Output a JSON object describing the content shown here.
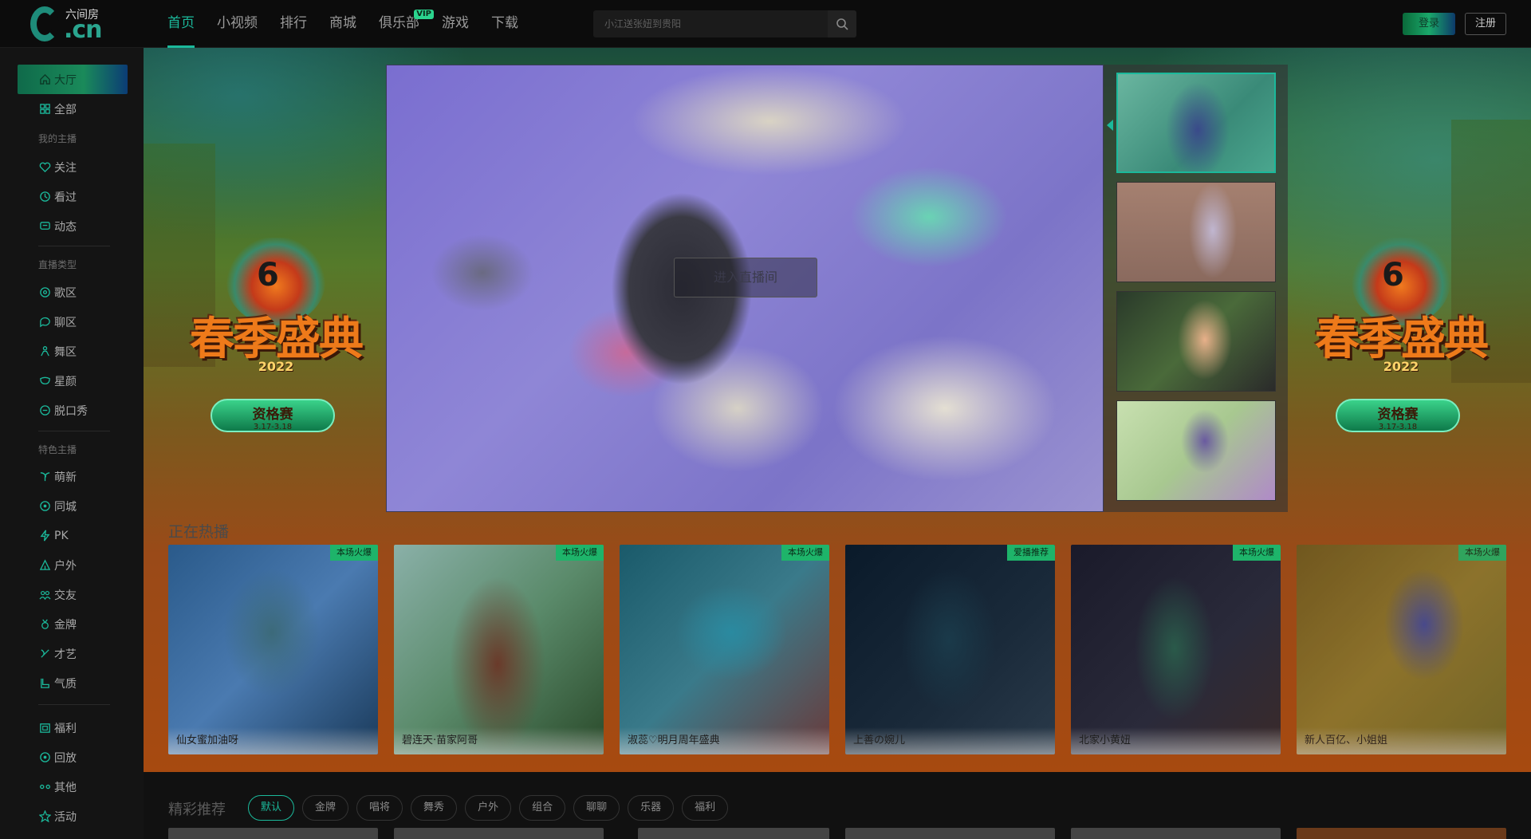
{
  "header": {
    "logo_text": "六间房",
    "logo_domain": ".cn",
    "nav": [
      {
        "label": "首页",
        "active": true
      },
      {
        "label": "小视频"
      },
      {
        "label": "排行"
      },
      {
        "label": "商城"
      },
      {
        "label": "俱乐部",
        "badge": "VIP"
      },
      {
        "label": "游戏"
      },
      {
        "label": "下载"
      }
    ],
    "search_placeholder": "小江送张妞到贵阳",
    "login_label": "登录",
    "register_label": "注册"
  },
  "sidebar": {
    "top_items": [
      {
        "label": "大厅",
        "icon": "home-icon",
        "active": true
      },
      {
        "label": "全部",
        "icon": "grid-icon"
      }
    ],
    "section_my": "我的主播",
    "my_items": [
      {
        "label": "关注",
        "icon": "heart-icon"
      },
      {
        "label": "看过",
        "icon": "clock-icon"
      },
      {
        "label": "动态",
        "icon": "message-icon"
      }
    ],
    "section_type": "直播类型",
    "type_items": [
      {
        "label": "歌区",
        "icon": "disc-icon"
      },
      {
        "label": "聊区",
        "icon": "chat-icon"
      },
      {
        "label": "舞区",
        "icon": "dance-icon"
      },
      {
        "label": "星颜",
        "icon": "mask-icon"
      },
      {
        "label": "脱口秀",
        "icon": "talk-icon"
      }
    ],
    "section_feature": "特色主播",
    "feature_items": [
      {
        "label": "萌新",
        "icon": "sprout-icon"
      },
      {
        "label": "同城",
        "icon": "location-icon"
      },
      {
        "label": "PK",
        "icon": "lightning-icon"
      },
      {
        "label": "户外",
        "icon": "tent-icon"
      },
      {
        "label": "交友",
        "icon": "friends-icon"
      },
      {
        "label": "金牌",
        "icon": "medal-icon"
      },
      {
        "label": "才艺",
        "icon": "talent-icon"
      },
      {
        "label": "气质",
        "icon": "boot-icon"
      }
    ],
    "extra_items": [
      {
        "label": "福利",
        "icon": "gift-icon"
      },
      {
        "label": "回放",
        "icon": "replay-icon"
      },
      {
        "label": "其他",
        "icon": "dots-icon"
      },
      {
        "label": "活动",
        "icon": "star-icon"
      }
    ]
  },
  "promo": {
    "title": "春季盛典",
    "year": "2022",
    "badge_title": "资格赛",
    "badge_dates": "3.17-3.18"
  },
  "player": {
    "enter_label": "进入直播间"
  },
  "hot": {
    "section_title": "正在热播",
    "cards": [
      {
        "name": "仙女蜜加油呀",
        "badge": "本场火爆"
      },
      {
        "name": "碧连天·苗家阿哥",
        "badge": "本场火爆"
      },
      {
        "name": "淑蕊♡明月周年盛典",
        "badge": "本场火爆"
      },
      {
        "name": "上善の婉儿",
        "badge": "爱播推荐"
      },
      {
        "name": "北家小黄妞",
        "badge": "本场火爆"
      },
      {
        "name": "新人百亿、小姐姐",
        "badge": "本场火爆"
      }
    ]
  },
  "featured": {
    "title": "精彩推荐",
    "filters": [
      {
        "label": "默认",
        "active": true
      },
      {
        "label": "金牌"
      },
      {
        "label": "唱将"
      },
      {
        "label": "舞秀"
      },
      {
        "label": "户外"
      },
      {
        "label": "组合"
      },
      {
        "label": "聊聊"
      },
      {
        "label": "乐器"
      },
      {
        "label": "福利"
      }
    ]
  }
}
